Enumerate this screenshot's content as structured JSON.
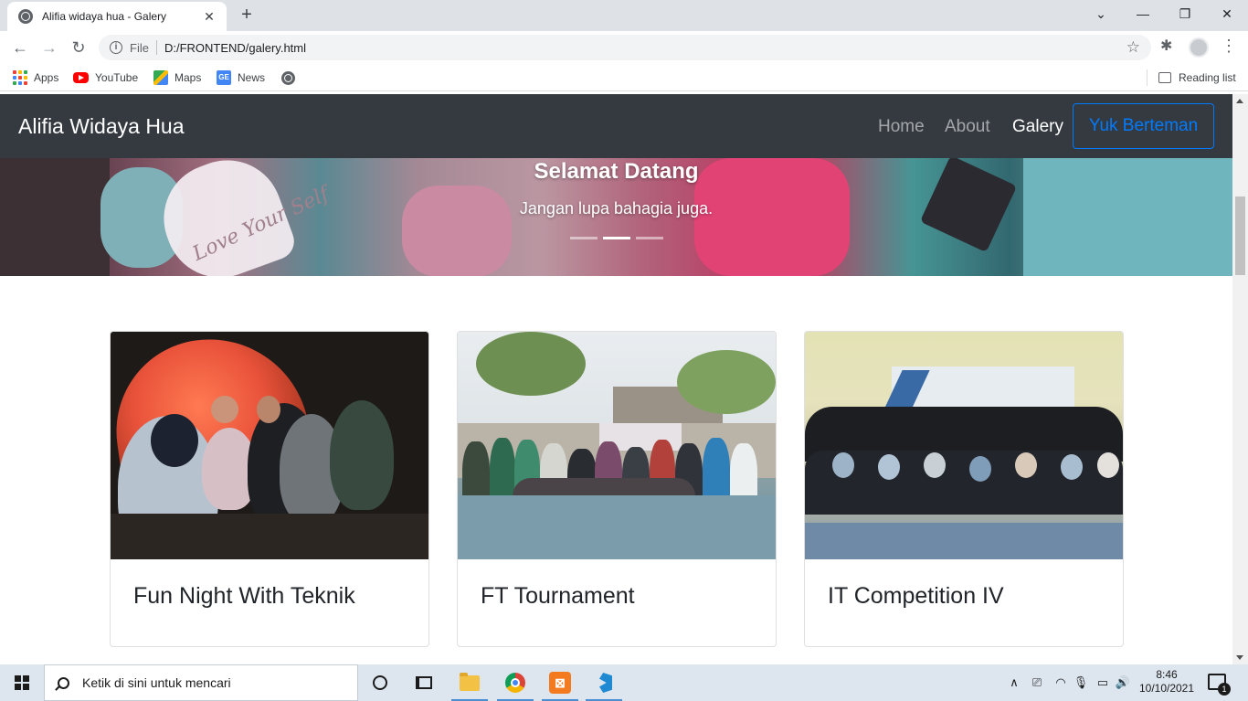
{
  "browser": {
    "tab_title": "Alifia widaya hua - Galery",
    "tab_close": "✕",
    "new_tab": "+",
    "window_controls": {
      "tabsearch": "⌄",
      "minimize": "—",
      "restore": "❐",
      "close": "✕"
    },
    "back": "←",
    "forward": "→",
    "reload": "↻",
    "scheme_label": "File",
    "url": "D:/FRONTEND/galery.html",
    "star": "☆",
    "extensions": "✱",
    "menu": "⋮"
  },
  "bookmarks": {
    "apps": "Apps",
    "youtube": "YouTube",
    "maps": "Maps",
    "news": "News",
    "news_badge": "GE",
    "reading_list": "Reading list"
  },
  "navbar": {
    "brand": "Alifia Widaya Hua",
    "links": [
      {
        "label": "Home",
        "active": false
      },
      {
        "label": "About",
        "active": false
      },
      {
        "label": "Galery",
        "active": true
      }
    ],
    "cta": "Yuk Berteman"
  },
  "hero": {
    "title": "Selamat Datang",
    "subtitle": "Jangan lupa bahagia juga.",
    "heart_text": "Love Your Self",
    "indicators": 3,
    "active_indicator": 1
  },
  "gallery": {
    "cards": [
      {
        "title": "Fun Night With Teknik"
      },
      {
        "title": "FT Tournament"
      },
      {
        "title": "IT Competition IV"
      }
    ]
  },
  "taskbar": {
    "search_placeholder": "Ketik di sini untuk mencari",
    "xampp_label": "⊠",
    "time": "8:46",
    "date": "10/10/2021",
    "notification_count": "1",
    "tray": {
      "chevron": "∧",
      "meet": "⎚",
      "wifi": "◠",
      "mic": "🎙",
      "battery": "▭",
      "volume": "🔊"
    }
  },
  "colors": {
    "navbar_bg": "#343a40",
    "primary": "#007bff",
    "tab_strip": "#dee1e6",
    "taskbar": "#dde5ee"
  }
}
